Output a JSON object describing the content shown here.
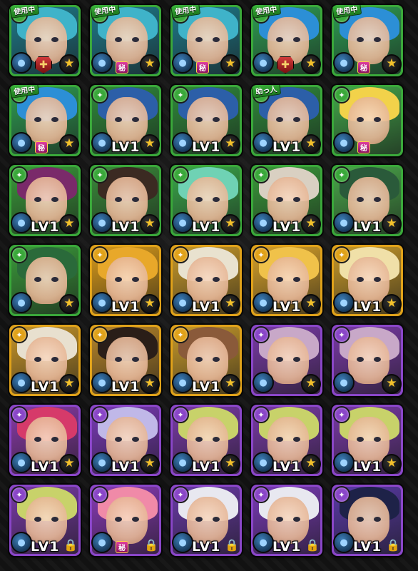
{
  "labels": {
    "in_use": "使用中",
    "helper": "助っ人",
    "level": "LV1",
    "secret": "秘"
  },
  "icons": {
    "element_icon": "element-orb-icon",
    "water_icon": "water-element-icon",
    "star_icon": "star-icon",
    "lock_icon": "lock-icon",
    "badge_icon": "sword-badge-icon"
  },
  "cards": [
    {
      "id": "c1",
      "elem": "#3aa83a",
      "tag": "in_use",
      "mark": "badge",
      "lv": "",
      "end": "star",
      "hair": "#3fb3c9",
      "bg": "#1e7a8a"
    },
    {
      "id": "c2",
      "elem": "#3aa83a",
      "tag": "in_use",
      "mark": "secret",
      "lv": "",
      "end": "star",
      "hair": "#3fb3c9",
      "bg": "#1e7a8a"
    },
    {
      "id": "c3",
      "elem": "#3aa83a",
      "tag": "in_use",
      "mark": "secret",
      "lv": "",
      "end": "star",
      "hair": "#3fb3c9",
      "bg": "#1e7a8a"
    },
    {
      "id": "c4",
      "elem": "#3aa83a",
      "tag": "in_use",
      "mark": "badge",
      "lv": "",
      "end": "star",
      "hair": "#2c8fd6",
      "bg": "#2e9d52"
    },
    {
      "id": "c5",
      "elem": "#3aa83a",
      "tag": "in_use",
      "mark": "secret",
      "lv": "",
      "end": "star",
      "hair": "#2c8fd6",
      "bg": "#2e9d52"
    },
    {
      "id": "c6",
      "elem": "#3aa83a",
      "tag": "in_use",
      "mark": "secret",
      "lv": "",
      "end": "star",
      "hair": "#2c8fd6",
      "bg": "#2e9d52"
    },
    {
      "id": "c7",
      "elem": "#3aa83a",
      "tag": "",
      "mark": "",
      "lv": "LV1",
      "end": "star",
      "hair": "#2c5fa8",
      "bg": "#2f8a3a"
    },
    {
      "id": "c8",
      "elem": "#3aa83a",
      "tag": "",
      "mark": "",
      "lv": "LV1",
      "end": "star",
      "hair": "#2c5fa8",
      "bg": "#2f8a3a"
    },
    {
      "id": "c9",
      "elem": "#3aa83a",
      "tag": "helper",
      "mark": "",
      "lv": "LV1",
      "end": "star",
      "hair": "#2c5fa8",
      "bg": "#2f8a3a"
    },
    {
      "id": "c10",
      "elem": "#3aa83a",
      "tag": "",
      "mark": "secret",
      "lv": "",
      "end": "",
      "hair": "#f2d24a",
      "bg": "#43a84a"
    },
    {
      "id": "c11",
      "elem": "#3aa83a",
      "tag": "",
      "mark": "",
      "lv": "LV1",
      "end": "star",
      "hair": "#7a2a6a",
      "bg": "#3a9a3a"
    },
    {
      "id": "c12",
      "elem": "#3aa83a",
      "tag": "",
      "mark": "",
      "lv": "LV1",
      "end": "star",
      "hair": "#3b2a22",
      "bg": "#3a8a3a"
    },
    {
      "id": "c13",
      "elem": "#3aa83a",
      "tag": "",
      "mark": "",
      "lv": "LV1",
      "end": "star",
      "hair": "#6fd2b4",
      "bg": "#3aa84a"
    },
    {
      "id": "c14",
      "elem": "#3aa83a",
      "tag": "",
      "mark": "",
      "lv": "LV1",
      "end": "star",
      "hair": "#d9d0c2",
      "bg": "#3a9a3a"
    },
    {
      "id": "c15",
      "elem": "#3aa83a",
      "tag": "",
      "mark": "",
      "lv": "LV1",
      "end": "star",
      "hair": "#2a5a3a",
      "bg": "#4aa84a"
    },
    {
      "id": "c16",
      "elem": "#3aa83a",
      "tag": "",
      "mark": "",
      "lv": "",
      "end": "star",
      "hair": "#2a6a3a",
      "bg": "#3a9a3a"
    },
    {
      "id": "c17",
      "elem": "#e0a21a",
      "tag": "",
      "mark": "",
      "lv": "LV1",
      "end": "star",
      "hair": "#e8a82a",
      "bg": "#d89a1a"
    },
    {
      "id": "c18",
      "elem": "#e0a21a",
      "tag": "",
      "mark": "",
      "lv": "LV1",
      "end": "star",
      "hair": "#e9e2cf",
      "bg": "#c99a2a"
    },
    {
      "id": "c19",
      "elem": "#e0a21a",
      "tag": "",
      "mark": "",
      "lv": "LV1",
      "end": "star",
      "hair": "#f0c24a",
      "bg": "#d8a22a"
    },
    {
      "id": "c20",
      "elem": "#e0a21a",
      "tag": "",
      "mark": "",
      "lv": "LV1",
      "end": "star",
      "hair": "#f0e0a8",
      "bg": "#c89a2a"
    },
    {
      "id": "c21",
      "elem": "#e0a21a",
      "tag": "",
      "mark": "",
      "lv": "LV1",
      "end": "star",
      "hair": "#e8e0cf",
      "bg": "#c8962a"
    },
    {
      "id": "c22",
      "elem": "#e0a21a",
      "tag": "",
      "mark": "",
      "lv": "LV1",
      "end": "star",
      "hair": "#2a1e18",
      "bg": "#b8862a"
    },
    {
      "id": "c23",
      "elem": "#e0a21a",
      "tag": "",
      "mark": "",
      "lv": "LV1",
      "end": "star",
      "hair": "#8a5a3a",
      "bg": "#c89a2a"
    },
    {
      "id": "c24",
      "elem": "#8a46c8",
      "tag": "",
      "mark": "",
      "lv": "",
      "end": "star",
      "hair": "#c8a8c8",
      "bg": "#7a3aa8"
    },
    {
      "id": "c25",
      "elem": "#8a46c8",
      "tag": "",
      "mark": "",
      "lv": "",
      "end": "star",
      "hair": "#c8a8c8",
      "bg": "#7a3aa8"
    },
    {
      "id": "c26",
      "elem": "#8a46c8",
      "tag": "",
      "mark": "",
      "lv": "LV1",
      "end": "star",
      "hair": "#d63a6a",
      "bg": "#8a3aa8"
    },
    {
      "id": "c27",
      "elem": "#8a46c8",
      "tag": "",
      "mark": "",
      "lv": "LV1",
      "end": "star",
      "hair": "#c0b8e8",
      "bg": "#7a3ab8"
    },
    {
      "id": "c28",
      "elem": "#8a46c8",
      "tag": "",
      "mark": "",
      "lv": "LV1",
      "end": "star",
      "hair": "#c8d26a",
      "bg": "#7a3aa8"
    },
    {
      "id": "c29",
      "elem": "#8a46c8",
      "tag": "",
      "mark": "",
      "lv": "LV1",
      "end": "star",
      "hair": "#c8d26a",
      "bg": "#7a3aa8"
    },
    {
      "id": "c30",
      "elem": "#8a46c8",
      "tag": "",
      "mark": "",
      "lv": "LV1",
      "end": "star",
      "hair": "#c8d26a",
      "bg": "#7a3aa8"
    },
    {
      "id": "c31",
      "elem": "#8a46c8",
      "tag": "",
      "mark": "",
      "lv": "LV1",
      "end": "lock",
      "hair": "#c8d26a",
      "bg": "#7a3aa8"
    },
    {
      "id": "c32",
      "elem": "#8a46c8",
      "tag": "",
      "mark": "secret",
      "lv": "",
      "end": "lock",
      "hair": "#f08aa8",
      "bg": "#8a3ab8"
    },
    {
      "id": "c33",
      "elem": "#8a46c8",
      "tag": "",
      "mark": "",
      "lv": "LV1",
      "end": "lock",
      "hair": "#e8e8f0",
      "bg": "#6a3aa8"
    },
    {
      "id": "c34",
      "elem": "#8a46c8",
      "tag": "",
      "mark": "",
      "lv": "LV1",
      "end": "lock",
      "hair": "#e8e8f0",
      "bg": "#7a3ab8"
    },
    {
      "id": "c35",
      "elem": "#8a46c8",
      "tag": "",
      "mark": "",
      "lv": "LV1",
      "end": "lock",
      "hair": "#1e2248",
      "bg": "#5a3aa8"
    }
  ]
}
